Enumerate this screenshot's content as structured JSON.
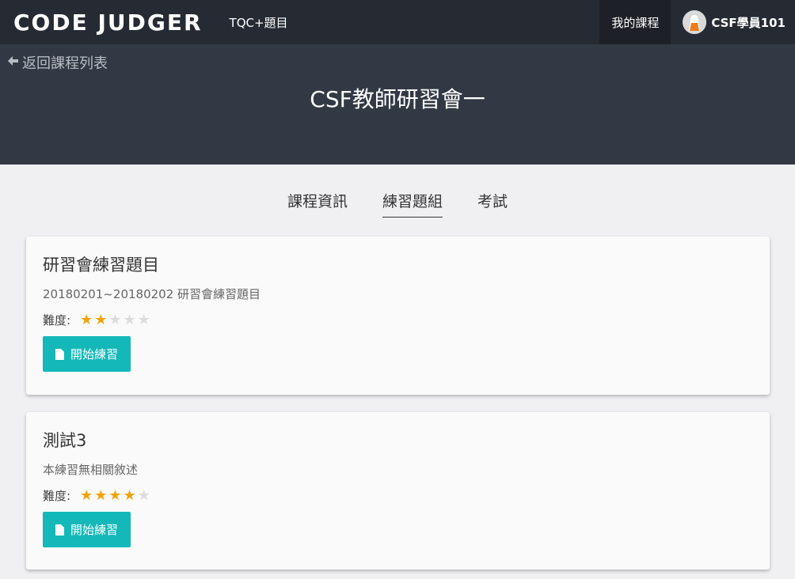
{
  "nav": {
    "brand": "CODE JUDGER",
    "link": "TQC+題目",
    "my_courses": "我的課程",
    "user_name": "CSF學員101"
  },
  "hero": {
    "back_label": "返回課程列表",
    "course_title": "CSF教師研習會一"
  },
  "tabs": [
    {
      "label": "課程資訊"
    },
    {
      "label": "練習題組"
    },
    {
      "label": "考試"
    }
  ],
  "cards": [
    {
      "title": "研習會練習題目",
      "description": "20180201~20180202 研習會練習題目",
      "difficulty_label": "難度:",
      "stars": 2,
      "stars_max": 5,
      "button_label": "開始練習"
    },
    {
      "title": "測試3",
      "description": "本練習無相關敘述",
      "difficulty_label": "難度:",
      "stars": 4,
      "stars_max": 5,
      "button_label": "開始練習"
    }
  ],
  "colors": {
    "nav_bg": "#262b33",
    "hero_bg": "#333944",
    "button": "#14b8b8",
    "star_on": "#f2a20a",
    "star_off": "#dcdcdc"
  }
}
